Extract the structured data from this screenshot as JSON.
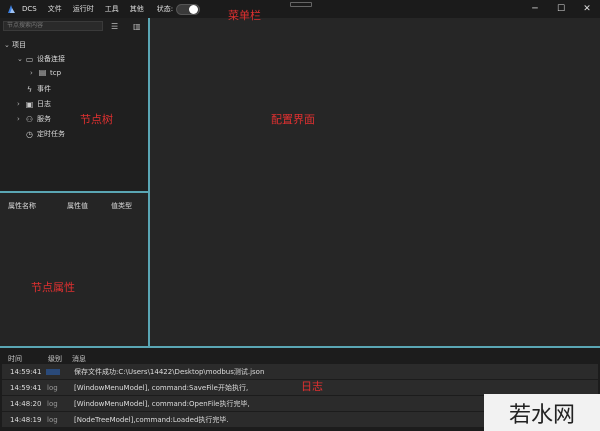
{
  "app": {
    "title": "DCS"
  },
  "menu": {
    "items": [
      "文件",
      "运行时",
      "工具",
      "其他"
    ],
    "status_label": "状态:",
    "status_on": true
  },
  "annotations": {
    "menubar": "菜单栏",
    "node_tree": "节点树",
    "config": "配置界面",
    "node_props": "节点属性",
    "log": "日志"
  },
  "search": {
    "placeholder": "节点搜索内容"
  },
  "tree": {
    "items": [
      {
        "label": "项目",
        "icon": "chevron-down-icon",
        "level": 0,
        "expanded": true
      },
      {
        "label": "设备连接",
        "icon": "device-connection-icon",
        "level": 1,
        "expanded": true
      },
      {
        "label": "tcp",
        "icon": "tcp-icon",
        "level": 2,
        "expanded": false
      },
      {
        "label": "事件",
        "icon": "event-icon",
        "level": 1
      },
      {
        "label": "日志",
        "icon": "log-icon",
        "level": 1,
        "expanded": false
      },
      {
        "label": "服务",
        "icon": "service-icon",
        "level": 1,
        "expanded": false
      },
      {
        "label": "定时任务",
        "icon": "timer-icon",
        "level": 1
      }
    ]
  },
  "props": {
    "headers": [
      "属性名称",
      "属性值",
      "值类型"
    ]
  },
  "logs": {
    "headers": [
      "时间",
      "级别",
      "消息"
    ],
    "rows": [
      {
        "time": "14:59:41",
        "level": "",
        "message": "保存文件成功:C:\\Users\\14422\\Desktop\\modbus测试.json"
      },
      {
        "time": "14:59:41",
        "level": "log",
        "message": "[WindowMenuModel], command:SaveFile开始执行,"
      },
      {
        "time": "14:48:20",
        "level": "log",
        "message": "[WindowMenuModel], command:OpenFile执行完毕,"
      },
      {
        "time": "14:48:19",
        "level": "log",
        "message": "[NodeTreeModel],command:Loaded执行完毕."
      }
    ]
  },
  "watermark": {
    "text": "若水网"
  },
  "colors": {
    "accent": "#5aa6b4",
    "annotation": "#e03030"
  }
}
